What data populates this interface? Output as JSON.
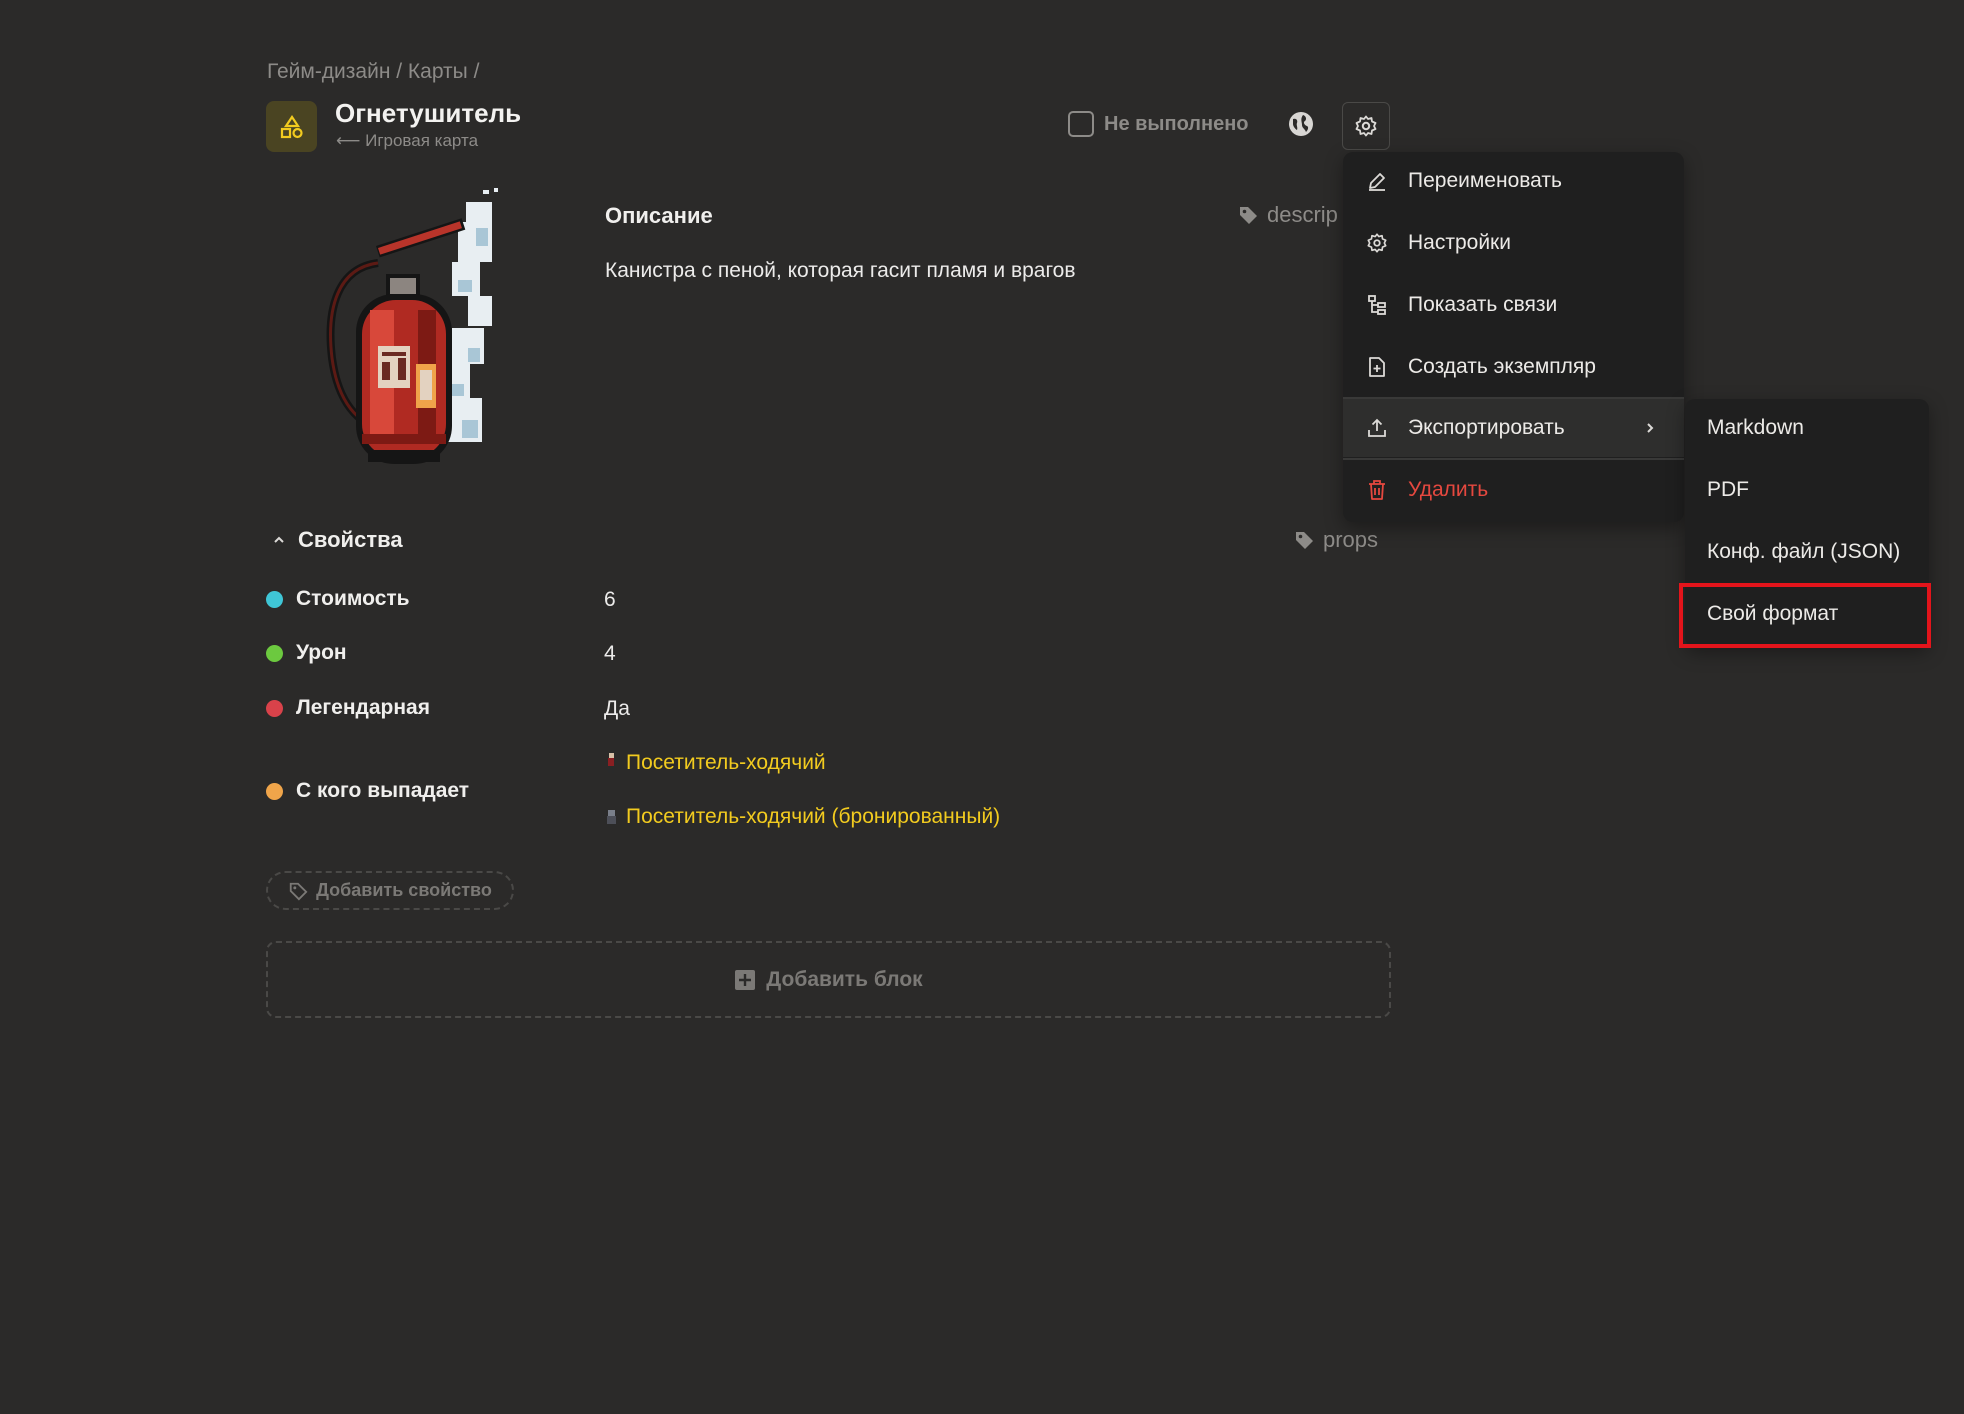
{
  "breadcrumb": "Гейм-дизайн / Карты /",
  "page": {
    "title": "Огнетушитель",
    "subtitle": "⟵ Игровая карта",
    "icon": "game-card-icon"
  },
  "status": {
    "label": "Не выполнено"
  },
  "description": {
    "heading": "Описание",
    "tag": "descrip",
    "text": "Канистра с пеной, которая гасит пламя и врагов"
  },
  "properties": {
    "heading": "Свойства",
    "tag": "props",
    "items": [
      {
        "label": "Стоимость",
        "value": "6",
        "color": "#3fc6d6"
      },
      {
        "label": "Урон",
        "value": "4",
        "color": "#6cc93f"
      },
      {
        "label": "Легендарная",
        "value": "Да",
        "color": "#d9424a"
      },
      {
        "label": "С кого выпадает",
        "color": "#f0a54a",
        "links": [
          "Посетитель-ходячий",
          "Посетитель-ходячий (бронированный)"
        ]
      }
    ],
    "add_label": "Добавить свойство"
  },
  "add_block_label": "Добавить блок",
  "menu": {
    "items": [
      {
        "label": "Переименовать",
        "icon": "pencil-icon"
      },
      {
        "label": "Настройки",
        "icon": "gear-icon"
      },
      {
        "label": "Показать связи",
        "icon": "tree-icon"
      },
      {
        "label": "Создать экземпляр",
        "icon": "file-plus-icon"
      },
      {
        "label": "Экспортировать",
        "icon": "upload-icon"
      },
      {
        "label": "Удалить",
        "icon": "trash-icon",
        "color": "#e5483f"
      }
    ]
  },
  "export_submenu": {
    "items": [
      "Markdown",
      "PDF",
      "Конф. файл (JSON)",
      "Свой формат"
    ],
    "highlighted": "Свой формат",
    "highlight_color": "#e3141b"
  },
  "colors": {
    "background": "#2b2a29",
    "link": "#f2cb1f",
    "muted": "#8d8b88"
  }
}
